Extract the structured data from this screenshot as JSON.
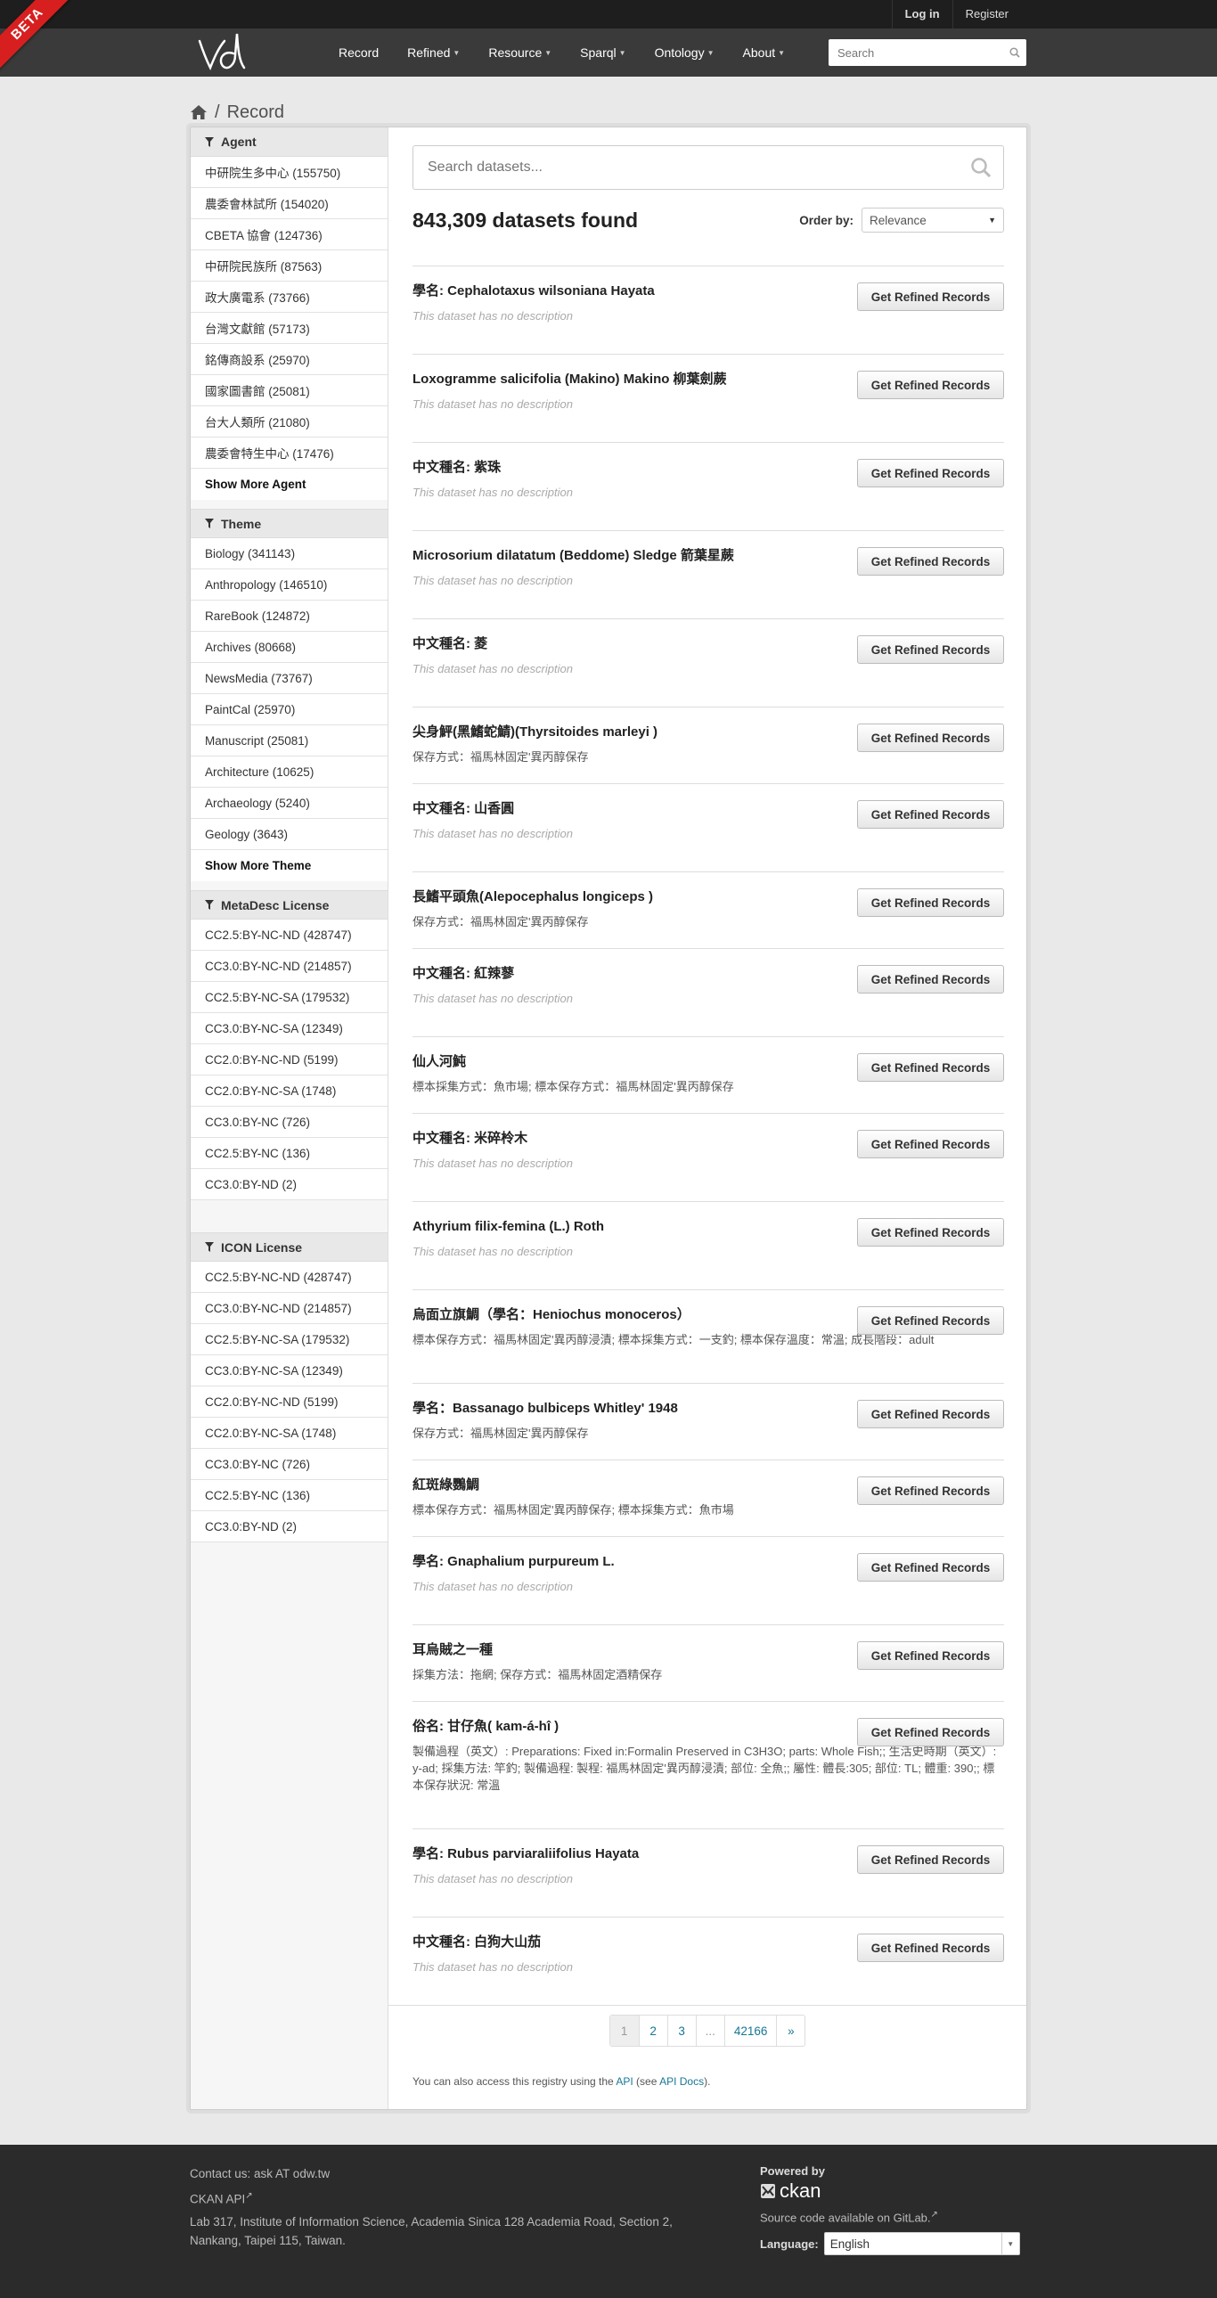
{
  "header": {
    "beta": "BETA",
    "login": "Log in",
    "register": "Register",
    "nav": [
      "Record",
      "Refined",
      "Resource",
      "Sparql",
      "Ontology",
      "About"
    ],
    "search_placeholder": "Search"
  },
  "breadcrumb": {
    "current": "Record"
  },
  "facets": [
    {
      "title": "Agent",
      "items": [
        "中研院生多中心 (155750)",
        "農委會林試所 (154020)",
        "CBETA 協會 (124736)",
        "中研院民族所 (87563)",
        "政大廣電系 (73766)",
        "台灣文獻館 (57173)",
        "銘傳商設系 (25970)",
        "國家圖書館 (25081)",
        "台大人類所 (21080)",
        "農委會特生中心 (17476)"
      ],
      "more": "Show More Agent"
    },
    {
      "title": "Theme",
      "items": [
        "Biology (341143)",
        "Anthropology (146510)",
        "RareBook (124872)",
        "Archives (80668)",
        "NewsMedia (73767)",
        "PaintCal (25970)",
        "Manuscript (25081)",
        "Architecture (10625)",
        "Archaeology (5240)",
        "Geology (3643)"
      ],
      "more": "Show More Theme"
    },
    {
      "title": "MetaDesc License",
      "items": [
        "CC2.5:BY-NC-ND (428747)",
        "CC3.0:BY-NC-ND (214857)",
        "CC2.5:BY-NC-SA (179532)",
        "CC3.0:BY-NC-SA (12349)",
        "CC2.0:BY-NC-ND (5199)",
        "CC2.0:BY-NC-SA (1748)",
        "CC3.0:BY-NC (726)",
        "CC2.5:BY-NC (136)",
        "CC3.0:BY-ND (2)"
      ],
      "more": ""
    },
    {
      "title": "ICON License",
      "items": [
        "CC2.5:BY-NC-ND (428747)",
        "CC3.0:BY-NC-ND (214857)",
        "CC2.5:BY-NC-SA (179532)",
        "CC3.0:BY-NC-SA (12349)",
        "CC2.0:BY-NC-ND (5199)",
        "CC2.0:BY-NC-SA (1748)",
        "CC3.0:BY-NC (726)",
        "CC2.5:BY-NC (136)",
        "CC3.0:BY-ND (2)"
      ],
      "more": ""
    }
  ],
  "search": {
    "placeholder": "Search datasets..."
  },
  "results": {
    "count": "843,309 datasets found",
    "order_label": "Order by:",
    "order_value": "Relevance",
    "button_label": "Get Refined Records",
    "no_desc": "This dataset has no description",
    "items": [
      {
        "title": "學名: Cephalotaxus wilsoniana Hayata",
        "desc": ""
      },
      {
        "title": "Loxogramme salicifolia (Makino) Makino 柳葉劍蕨",
        "desc": ""
      },
      {
        "title": "中文種名: 紫珠",
        "desc": ""
      },
      {
        "title": "Microsorium dilatatum (Beddome) Sledge 箭葉星蕨",
        "desc": ""
      },
      {
        "title": "中文種名: 菱",
        "desc": ""
      },
      {
        "title": "尖身鮃(黑鰭蛇鯖)(Thyrsitoides marleyi )",
        "desc": "保存方式：福馬林固定'異丙醇保存"
      },
      {
        "title": "中文種名: 山香圓",
        "desc": ""
      },
      {
        "title": "長鰭平頭魚(Alepocephalus longiceps )",
        "desc": "保存方式：福馬林固定'異丙醇保存"
      },
      {
        "title": "中文種名: 紅辣蓼",
        "desc": ""
      },
      {
        "title": "仙人河魨",
        "desc": "標本採集方式：魚市場; 標本保存方式：福馬林固定'異丙醇保存"
      },
      {
        "title": "中文種名: 米碎柃木",
        "desc": ""
      },
      {
        "title": "Athyrium filix-femina (L.) Roth",
        "desc": ""
      },
      {
        "title": "烏面立旗鯛（學名：Heniochus monoceros）",
        "desc": "標本保存方式：福馬林固定'異丙醇浸漬; 標本採集方式：一支釣; 標本保存溫度：常溫; 成長階段：adult"
      },
      {
        "title": "學名：Bassanago bulbiceps Whitley' 1948",
        "desc": "保存方式：福馬林固定'異丙醇保存"
      },
      {
        "title": "紅斑綠鸚鯛",
        "desc": "標本保存方式：福馬林固定'異丙醇保存; 標本採集方式：魚市場"
      },
      {
        "title": "學名: Gnaphalium purpureum L.",
        "desc": ""
      },
      {
        "title": "耳烏賊之一種",
        "desc": "採集方法：拖網; 保存方式：福馬林固定酒精保存"
      },
      {
        "title": "俗名: 甘仔魚( kam-á-hî )",
        "desc": "製備過程（英文）: Preparations: Fixed in:Formalin Preserved in C3H3O; parts: Whole Fish;; 生活史時期（英文）: y-ad; 採集方法: 竿釣; 製備過程: 製程: 福馬林固定'異丙醇浸漬; 部位: 全魚;; 屬性: 體長:305; 部位: TL; 體重: 390;; 標本保存狀況: 常溫"
      },
      {
        "title": "學名: Rubus parviaraliifolius Hayata",
        "desc": ""
      },
      {
        "title": "中文種名: 白狗大山茄",
        "desc": ""
      }
    ]
  },
  "pagination": [
    "1",
    "2",
    "3",
    "...",
    "42166",
    "»"
  ],
  "api_note": {
    "before": "You can also access this registry using the ",
    "api": "API",
    "middle": " (see ",
    "docs": "API Docs",
    "after": ")."
  },
  "footer": {
    "contact": "Contact us: ask AT odw.tw",
    "ckan_api": "CKAN API",
    "address": "Lab 317, Institute of Information Science, Academia Sinica 128 Academia Road, Section 2, Nankang, Taipei 115, Taiwan.",
    "powered_by": "Powered by",
    "ckan": "ckan",
    "source_before": "Source code available on ",
    "source_link": "GitLab.",
    "language_label": "Language:",
    "language_value": "English"
  },
  "colors": {
    "topbar": "#1e1e1e",
    "masthead": "#3a3a3a",
    "link": "#187794",
    "beta": "#d81f1f",
    "footer": "#2b2b2b"
  }
}
